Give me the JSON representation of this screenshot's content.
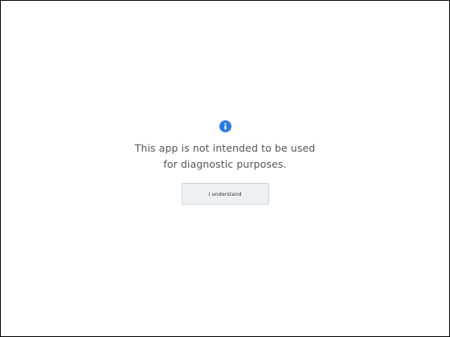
{
  "dialog": {
    "icon": "info-icon",
    "message_line1": "This app is not intended to be used",
    "message_line2": "for diagnostic purposes.",
    "button_label": "I understand"
  },
  "colors": {
    "icon": "#2d7be0",
    "text": "#555555",
    "button_bg": "#eef1f4",
    "border": "#000000"
  }
}
